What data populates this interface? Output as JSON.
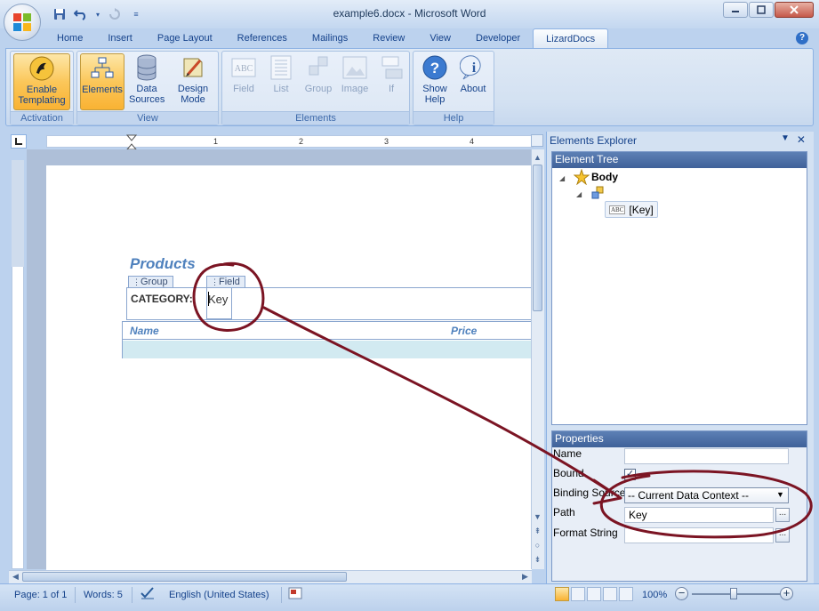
{
  "window": {
    "title": "example6.docx - Microsoft Word"
  },
  "ribbon": {
    "tabs": [
      "Home",
      "Insert",
      "Page Layout",
      "References",
      "Mailings",
      "Review",
      "View",
      "Developer",
      "LizardDocs"
    ],
    "active_tab": "LizardDocs",
    "groups": {
      "activation": {
        "label": "Activation",
        "enable_templating": "Enable Templating"
      },
      "view": {
        "label": "View",
        "elements": "Elements",
        "data_sources": "Data Sources",
        "design_mode": "Design Mode"
      },
      "elements": {
        "label": "Elements",
        "field": "Field",
        "list": "List",
        "group": "Group",
        "image": "Image",
        "if": "If"
      },
      "help": {
        "label": "Help",
        "show_help": "Show Help",
        "about": "About"
      }
    }
  },
  "ruler": {
    "numbers": [
      "1",
      "2",
      "3",
      "4"
    ]
  },
  "document": {
    "title": "Products",
    "group_tag": "Group",
    "field_tag": "Field",
    "category_label": "CATEGORY:",
    "field_value": "Key",
    "table": {
      "columns": [
        "Name",
        "Price"
      ]
    }
  },
  "task_pane": {
    "title": "Elements Explorer",
    "element_tree": {
      "header": "Element Tree",
      "root": "Body",
      "leaf": "[Key]",
      "leaf_icon_text": "ABC"
    },
    "properties": {
      "header": "Properties",
      "labels": {
        "name": "Name",
        "bound": "Bound",
        "binding_source": "Binding Source",
        "path": "Path",
        "format_string": "Format String"
      },
      "values": {
        "name": "",
        "bound": true,
        "binding_source": "-- Current Data Context --",
        "path": "Key",
        "format_string": ""
      },
      "ellipsis": "..."
    }
  },
  "statusbar": {
    "page": "Page: 1 of 1",
    "words": "Words: 5",
    "language": "English (United States)",
    "zoom": "100%"
  },
  "colors": {
    "ribbon_bg": "#dfe9f5",
    "accent_highlight": "#f9b233",
    "heading_blue": "#4f81bd",
    "annotation": "#7b1423"
  },
  "annotation": {
    "type": "hand-drawn circles with arrow linking the document field to its Path property"
  }
}
